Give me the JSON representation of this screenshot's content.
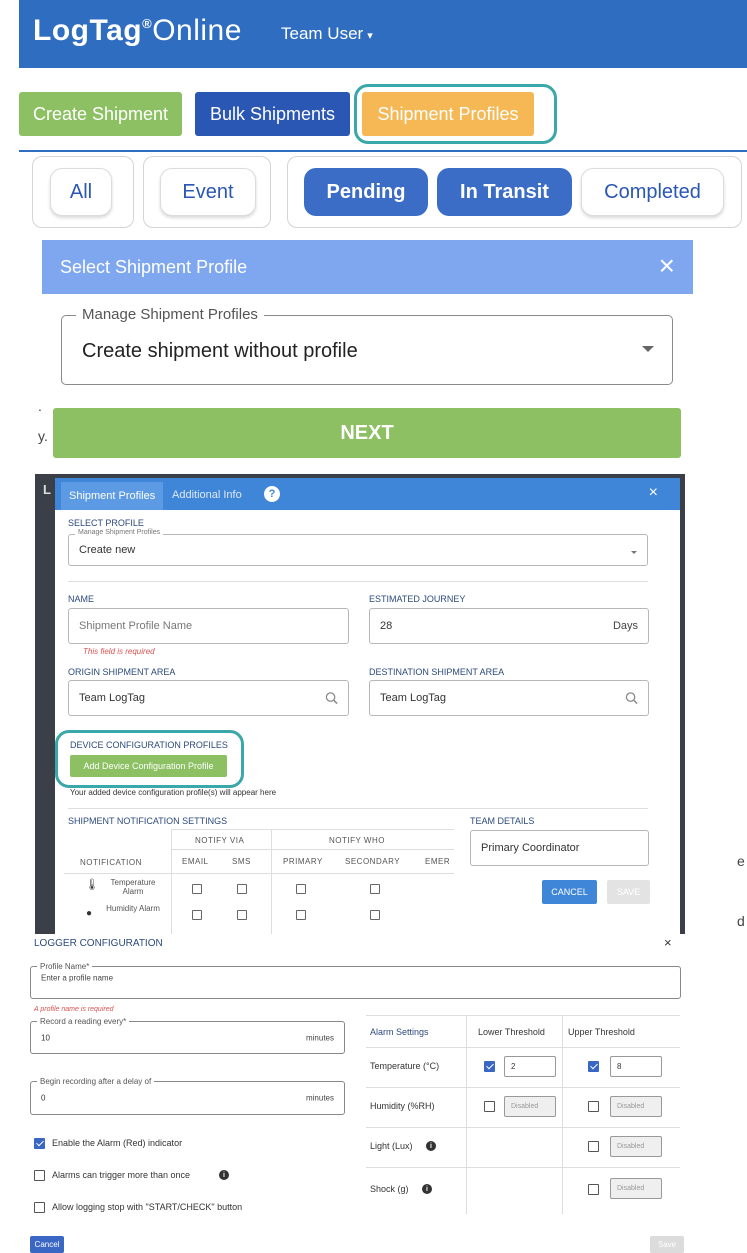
{
  "navbar": {
    "brand": "LogTag",
    "brand_reg": "®",
    "brand_suffix": "Online",
    "user_menu": "Team User",
    "bg_color": "#2f6dc1"
  },
  "actions": {
    "create": "Create Shipment",
    "bulk": "Bulk Shipments",
    "profiles": "Shipment Profiles"
  },
  "filters": {
    "all": "All",
    "event": "Event",
    "pending": "Pending",
    "in_transit": "In Transit",
    "completed": "Completed"
  },
  "select_dialog": {
    "title": "Select Shipment Profile",
    "close_icon": "×",
    "field_label": "Manage Shipment Profiles",
    "field_value": "Create shipment without profile",
    "next_label": "NEXT",
    "header_color": "#7ea7ef"
  },
  "profile_modal": {
    "tab_active": "Shipment Profiles",
    "tab_other": "Additional Info",
    "help_icon": "?",
    "close_icon": "×",
    "select_profile_label": "SELECT PROFILE",
    "select_profile_legend": "Manage Shipment Profiles",
    "select_profile_value": "Create new",
    "name_label": "NAME",
    "name_placeholder": "Shipment Profile Name",
    "name_error": "This field is required",
    "journey_label": "ESTIMATED JOURNEY",
    "journey_value": "28",
    "journey_unit": "Days",
    "origin_label": "ORIGIN SHIPMENT AREA",
    "origin_value": "Team LogTag",
    "destination_label": "DESTINATION SHIPMENT AREA",
    "destination_value": "Team LogTag",
    "device_config_label": "DEVICE CONFIGURATION PROFILES",
    "add_device_config_button": "Add Device Configuration Profile",
    "device_config_note": "Your added device configuration profile(s) will appear here",
    "notification_settings_label": "SHIPMENT NOTIFICATION SETTINGS",
    "team_details_label": "TEAM DETAILS",
    "team_details_value": "Primary Coordinator",
    "notify_via": "NOTIFY VIA",
    "notify_who": "NOTIFY WHO",
    "col_notification": "NOTIFICATION",
    "col_email": "EMAIL",
    "col_sms": "SMS",
    "col_primary": "PRIMARY",
    "col_secondary": "SECONDARY",
    "col_emer": "EMER",
    "rows": [
      {
        "icon": "thermometer-icon",
        "label": "Temperature Alarm"
      },
      {
        "icon": "droplet-icon",
        "label": "Humidity Alarm"
      }
    ],
    "cancel": "CANCEL",
    "save": "SAVE"
  },
  "logger_config": {
    "title": "LOGGER CONFIGURATION",
    "close_icon": "×",
    "profile_name_legend": "Profile Name*",
    "profile_name_placeholder": "Enter a profile name",
    "profile_name_error": "A profile name is required",
    "record_legend": "Record a reading every*",
    "record_value": "10",
    "record_unit": "minutes",
    "delay_legend": "Begin recording after a delay of",
    "delay_value": "0",
    "delay_unit": "minutes",
    "check_alarm_indicator": "Enable the Alarm (Red) indicator",
    "check_alarm_indicator_on": true,
    "check_multi_trigger": "Alarms can trigger more than once",
    "check_multi_trigger_on": false,
    "check_logging_stop": "Allow logging stop with \"START/CHECK\" button",
    "check_logging_stop_on": false,
    "alarm_header": "Alarm Settings",
    "lower_header": "Lower Threshold",
    "upper_header": "Upper Threshold",
    "rows": [
      {
        "label": "Temperature (°C)",
        "lower_checked": true,
        "lower_value": "2",
        "upper_checked": true,
        "upper_value": "8"
      },
      {
        "label": "Humidity (%RH)",
        "lower_checked": false,
        "lower_value": "Disabled",
        "upper_checked": false,
        "upper_value": "Disabled"
      },
      {
        "label": "Light (Lux)",
        "upper_checked": false,
        "upper_value": "Disabled"
      },
      {
        "label": "Shock (g)",
        "upper_checked": false,
        "upper_value": "Disabled"
      }
    ],
    "cancel": "Cancel",
    "save": "Save"
  }
}
